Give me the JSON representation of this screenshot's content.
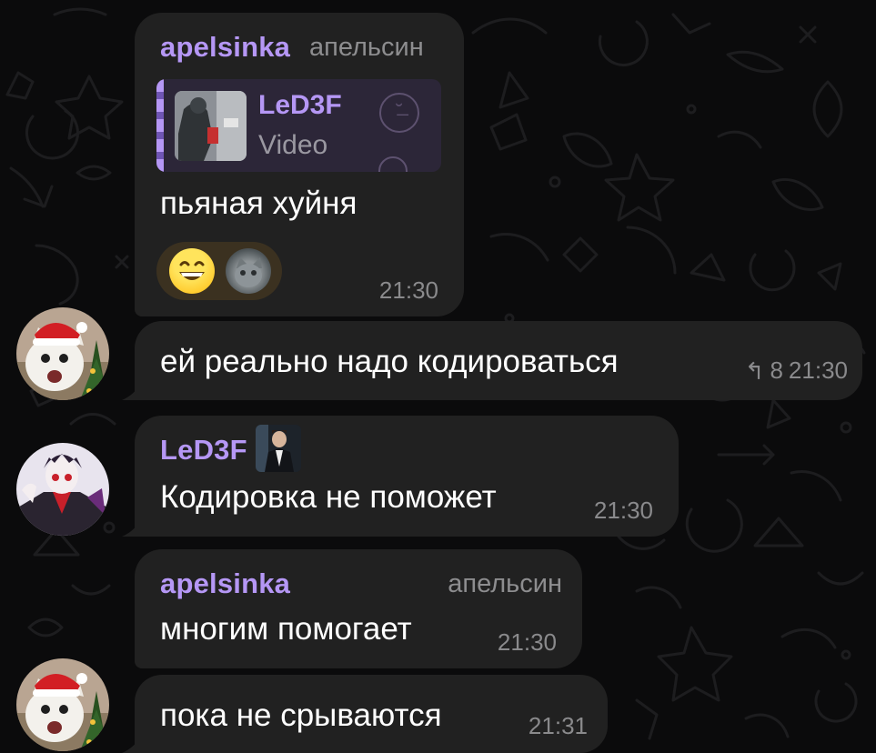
{
  "colors": {
    "background": "#0b0b0c",
    "bubble": "#212121",
    "accent_name": "#b597f5",
    "muted_text": "#8a8a8c"
  },
  "messages": [
    {
      "sender": "apelsinka",
      "role": "апельсин",
      "reply": {
        "sender": "LeD3F",
        "type": "Video"
      },
      "text": "пьяная хуйня",
      "reactions": [
        "grinning-face-emoji",
        "cat-avatar"
      ],
      "time": "21:30"
    },
    {
      "text": "ей реально надо кодироваться",
      "replies": "8",
      "time": "21:30"
    },
    {
      "sender": "LeD3F",
      "text": "Кодировка не поможет",
      "time": "21:30"
    },
    {
      "sender": "apelsinka",
      "role": "апельсин",
      "text": "многим помогает",
      "time": "21:30"
    },
    {
      "text": "пока не срываются",
      "time": "21:31"
    }
  ]
}
